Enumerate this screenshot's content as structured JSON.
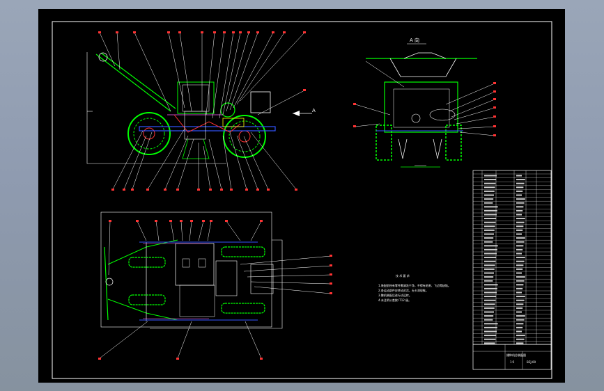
{
  "drawing": {
    "view_label": "A 向",
    "arrow_label": "A",
    "notes_title": "技 术 要 求",
    "notes": [
      "1.装配前所有零件需清洗干净，不得有毛刺、飞边等缺陷。",
      "2.各运动部件应转动灵活，无卡滞现象。",
      "3.整机装配后进行试运转。",
      "4.未注明公差按 IT12 级。"
    ],
    "title_block": {
      "title": "播种机总装配图",
      "drawing_no": "BZJ-00",
      "scale": "1:5"
    }
  },
  "colors": {
    "background": "#8f9bb0",
    "sheet": "#000000",
    "outline": "#ffffff",
    "parts": "#00ff00",
    "leader": "#ff3333",
    "dimension": "#ff66ff",
    "axis": "#3355ff",
    "accent": "#ffff00"
  }
}
